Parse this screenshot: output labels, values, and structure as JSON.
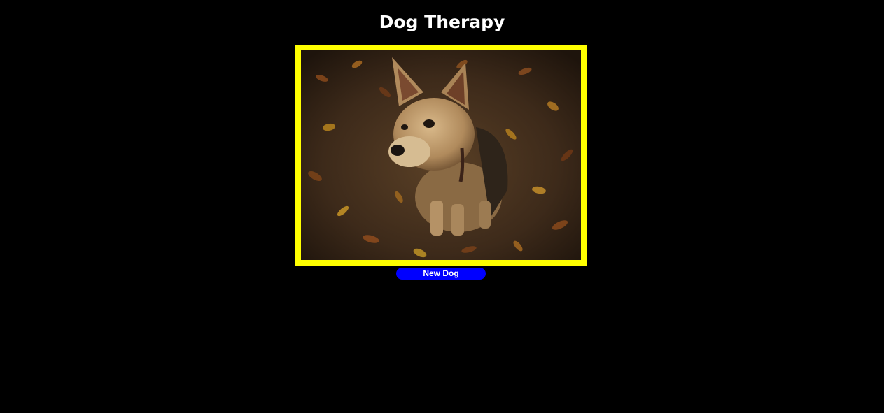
{
  "header": {
    "title": "Dog Therapy"
  },
  "photo": {
    "subject": "dog-photo",
    "frame_color": "#ffff00"
  },
  "controls": {
    "new_dog_label": "New Dog",
    "button_color": "#0000ff"
  }
}
